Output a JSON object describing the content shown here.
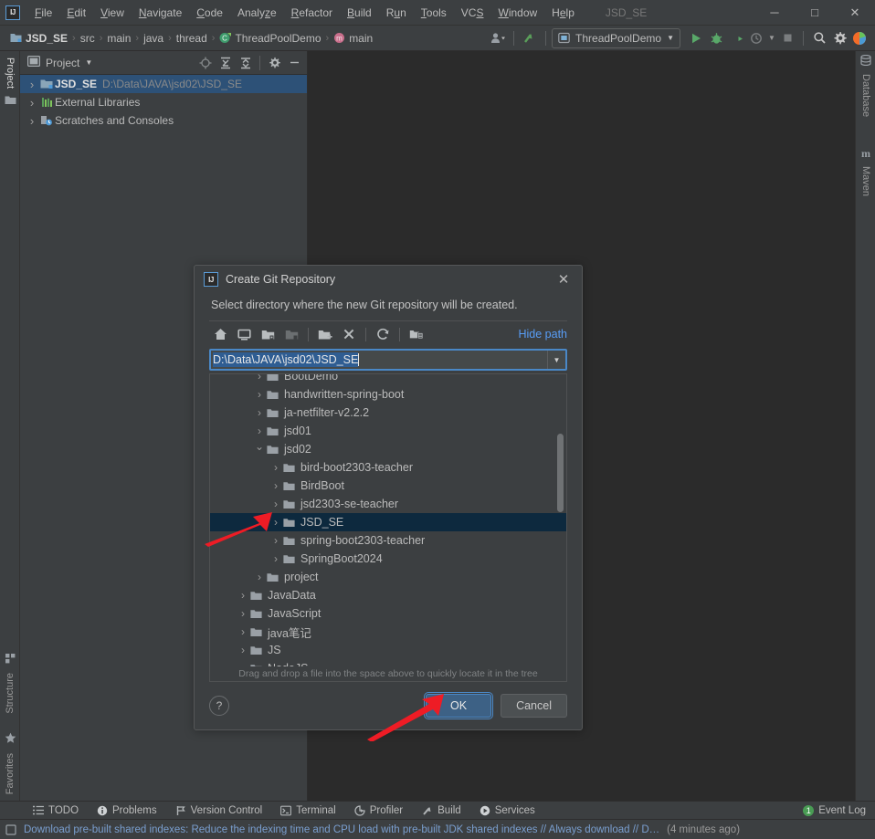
{
  "window": {
    "title": "JSD_SE",
    "minimize": "─",
    "maximize": "□",
    "close": "✕",
    "logo_text": "IJ"
  },
  "menu": [
    {
      "label": "File",
      "mnemonic": "F"
    },
    {
      "label": "Edit",
      "mnemonic": "E"
    },
    {
      "label": "View",
      "mnemonic": "V"
    },
    {
      "label": "Navigate",
      "mnemonic": "N"
    },
    {
      "label": "Code",
      "mnemonic": "C"
    },
    {
      "label": "Analyze",
      "mnemonic": "z"
    },
    {
      "label": "Refactor",
      "mnemonic": "R"
    },
    {
      "label": "Build",
      "mnemonic": "B"
    },
    {
      "label": "Run",
      "mnemonic": "u"
    },
    {
      "label": "Tools",
      "mnemonic": "T"
    },
    {
      "label": "VCS",
      "mnemonic": "S"
    },
    {
      "label": "Window",
      "mnemonic": "W"
    },
    {
      "label": "Help",
      "mnemonic": "e"
    }
  ],
  "breadcrumbs": [
    {
      "label": "JSD_SE",
      "icon": "project-icon",
      "bold": true
    },
    {
      "label": "src",
      "icon": "",
      "bold": false
    },
    {
      "label": "main",
      "icon": "",
      "bold": false
    },
    {
      "label": "java",
      "icon": "",
      "bold": false
    },
    {
      "label": "thread",
      "icon": "",
      "bold": false
    },
    {
      "label": "ThreadPoolDemo",
      "icon": "class-icon",
      "bold": false
    },
    {
      "label": "main",
      "icon": "method-icon",
      "bold": false
    }
  ],
  "toolbar": {
    "run_config": "ThreadPoolDemo",
    "icons": [
      "user-dropdown-icon",
      "update-project-icon",
      "run-icon",
      "debug-icon",
      "run-coverage-icon",
      "profiler-icon",
      "stop-icon",
      "search-everywhere-icon",
      "settings-icon",
      "idea-assistant-icon"
    ]
  },
  "project_panel": {
    "title": "Project",
    "header_icons": [
      "locate-icon",
      "expand-all-icon",
      "collapse-all-icon",
      "gear-icon",
      "hide-icon"
    ],
    "items": [
      {
        "label": "JSD_SE",
        "path": "D:\\Data\\JAVA\\jsd02\\JSD_SE",
        "icon": "module-icon",
        "selected": true,
        "indent": 0,
        "arrow": "right"
      },
      {
        "label": "External Libraries",
        "path": "",
        "icon": "libraries-icon",
        "selected": false,
        "indent": 0,
        "arrow": "right"
      },
      {
        "label": "Scratches and Consoles",
        "path": "",
        "icon": "scratches-icon",
        "selected": false,
        "indent": 0,
        "arrow": "right"
      }
    ]
  },
  "left_tool_tabs": [
    {
      "label": "Project",
      "icon": "project-tab-icon",
      "selected": true
    },
    {
      "label": "Structure",
      "icon": "structure-icon",
      "selected": false
    },
    {
      "label": "Favorites",
      "icon": "star-icon",
      "selected": false
    }
  ],
  "right_tool_tabs": [
    {
      "label": "Database",
      "icon": "database-icon"
    },
    {
      "label": "Maven",
      "icon": "maven-icon"
    }
  ],
  "bottom_tool_tabs": [
    {
      "label": "TODO",
      "icon": "todo-icon"
    },
    {
      "label": "Problems",
      "icon": "problems-icon"
    },
    {
      "label": "Version Control",
      "icon": "version-control-icon"
    },
    {
      "label": "Terminal",
      "icon": "terminal-icon"
    },
    {
      "label": "Profiler",
      "icon": "profiler-icon"
    },
    {
      "label": "Build",
      "icon": "build-icon"
    },
    {
      "label": "Services",
      "icon": "services-icon"
    }
  ],
  "event_log": {
    "label": "Event Log",
    "count": "1"
  },
  "statusbar": {
    "icon": "notification-icon",
    "message": "Download pre-built shared indexes: Reduce the indexing time and CPU load with pre-built JDK shared indexes // Always download // D…",
    "timestamp": "(4 minutes ago)"
  },
  "dialog": {
    "title": "Create Git Repository",
    "description": "Select directory where the new Git repository will be created.",
    "close_label": "✕",
    "hide_path_label": "Hide path",
    "path_value": "D:\\Data\\JAVA\\jsd02\\JSD_SE",
    "path_dropdown_icon": "chevron-down-icon",
    "toolbar_icons": [
      {
        "name": "home-icon",
        "disabled": false
      },
      {
        "name": "desktop-icon",
        "disabled": false
      },
      {
        "name": "project-dir-icon",
        "disabled": false
      },
      {
        "name": "module-dir-icon",
        "disabled": true
      },
      {
        "name": "new-folder-icon",
        "disabled": false
      },
      {
        "name": "delete-icon",
        "disabled": false
      },
      {
        "name": "refresh-icon",
        "disabled": false
      },
      {
        "name": "show-hidden-icon",
        "disabled": false
      }
    ],
    "tree": [
      {
        "label": "BootDemo",
        "indent": 2,
        "arrow": "right",
        "selected": false,
        "clipped": true
      },
      {
        "label": "handwritten-spring-boot",
        "indent": 2,
        "arrow": "right",
        "selected": false
      },
      {
        "label": "ja-netfilter-v2.2.2",
        "indent": 2,
        "arrow": "right",
        "selected": false
      },
      {
        "label": "jsd01",
        "indent": 2,
        "arrow": "right",
        "selected": false
      },
      {
        "label": "jsd02",
        "indent": 2,
        "arrow": "down",
        "selected": false
      },
      {
        "label": "bird-boot2303-teacher",
        "indent": 3,
        "arrow": "right",
        "selected": false
      },
      {
        "label": "BirdBoot",
        "indent": 3,
        "arrow": "right",
        "selected": false
      },
      {
        "label": "jsd2303-se-teacher",
        "indent": 3,
        "arrow": "right",
        "selected": false
      },
      {
        "label": "JSD_SE",
        "indent": 3,
        "arrow": "right",
        "selected": true
      },
      {
        "label": "spring-boot2303-teacher",
        "indent": 3,
        "arrow": "right",
        "selected": false
      },
      {
        "label": "SpringBoot2024",
        "indent": 3,
        "arrow": "right",
        "selected": false
      },
      {
        "label": "project",
        "indent": 2,
        "arrow": "right",
        "selected": false
      },
      {
        "label": "JavaData",
        "indent": 1,
        "arrow": "right",
        "selected": false
      },
      {
        "label": "JavaScript",
        "indent": 1,
        "arrow": "right",
        "selected": false
      },
      {
        "label": "java笔记",
        "indent": 1,
        "arrow": "right",
        "selected": false
      },
      {
        "label": "JS",
        "indent": 1,
        "arrow": "right",
        "selected": false
      },
      {
        "label": "NodeJS",
        "indent": 1,
        "arrow": "right",
        "selected": false
      }
    ],
    "hint": "Drag and drop a file into the space above to quickly locate it in the tree",
    "help_label": "?",
    "ok_label": "OK",
    "cancel_label": "Cancel"
  },
  "colors": {
    "accent_blue": "#4a88c7",
    "link_blue": "#589df6",
    "selection_navy": "#0d293e",
    "project_selection": "#2d5177",
    "annotation_red": "#ee1c25",
    "panel_bg": "#3c3f41",
    "editor_bg": "#2b2b2b",
    "green": "#499c54"
  }
}
